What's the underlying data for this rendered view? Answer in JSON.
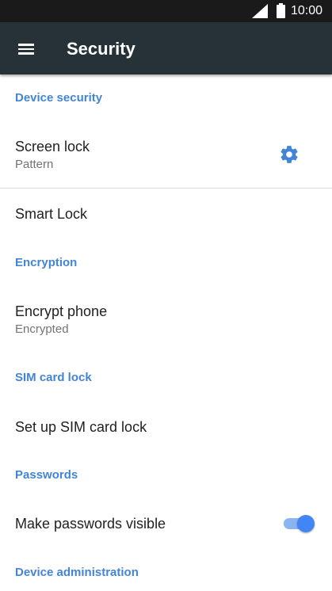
{
  "status_bar": {
    "time": "10:00",
    "icons": [
      "signal-icon",
      "battery-icon"
    ]
  },
  "app_bar": {
    "title": "Security",
    "menu_icon": "hamburger-menu-icon"
  },
  "sections": [
    {
      "header": "Device security"
    },
    {
      "header": "Encryption"
    },
    {
      "header": "SIM card lock"
    },
    {
      "header": "Passwords"
    },
    {
      "header": "Device administration"
    }
  ],
  "items": {
    "screen_lock": {
      "title": "Screen lock",
      "summary": "Pattern",
      "settings_icon": "gear-icon"
    },
    "smart_lock": {
      "title": "Smart Lock"
    },
    "encrypt_phone": {
      "title": "Encrypt phone",
      "summary": "Encrypted"
    },
    "sim_lock": {
      "title": "Set up SIM card lock"
    },
    "passwords_visible": {
      "title": "Make passwords visible",
      "toggle_on": true
    }
  },
  "colors": {
    "status_bar": "#1a1a1a",
    "app_bar": "#263238",
    "accent": "#4285d6",
    "toggle_thumb": "#4285f4",
    "toggle_track": "#8ab4f2"
  }
}
